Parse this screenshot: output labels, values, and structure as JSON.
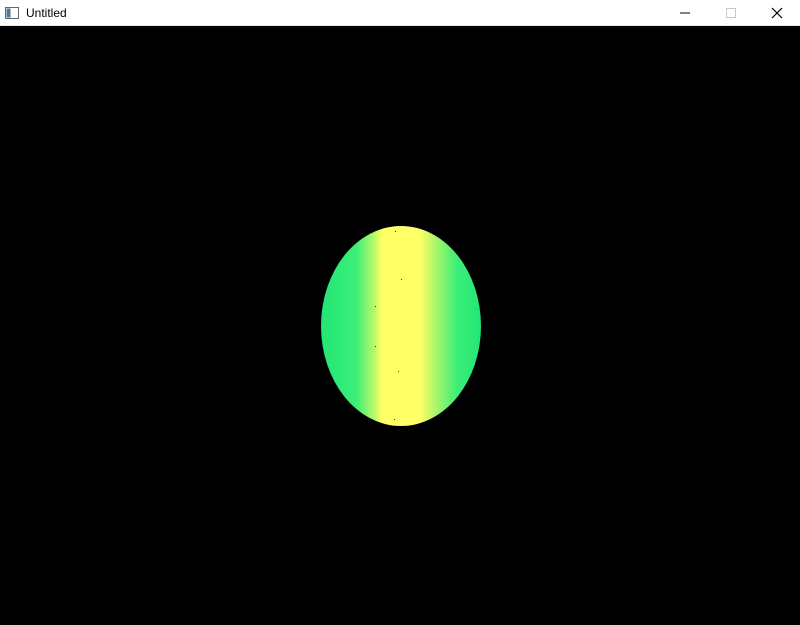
{
  "window": {
    "title": "Untitled",
    "icon": "app-window-icon",
    "controls": {
      "minimize_icon": "minimize-icon",
      "maximize_icon": "maximize-icon",
      "close_icon": "close-icon"
    }
  },
  "scene": {
    "background_color": "#000000",
    "object": "shaded-sphere",
    "colors": {
      "edge": "#22e676",
      "mid": "#8cf36a",
      "highlight": "#ffff66"
    }
  }
}
